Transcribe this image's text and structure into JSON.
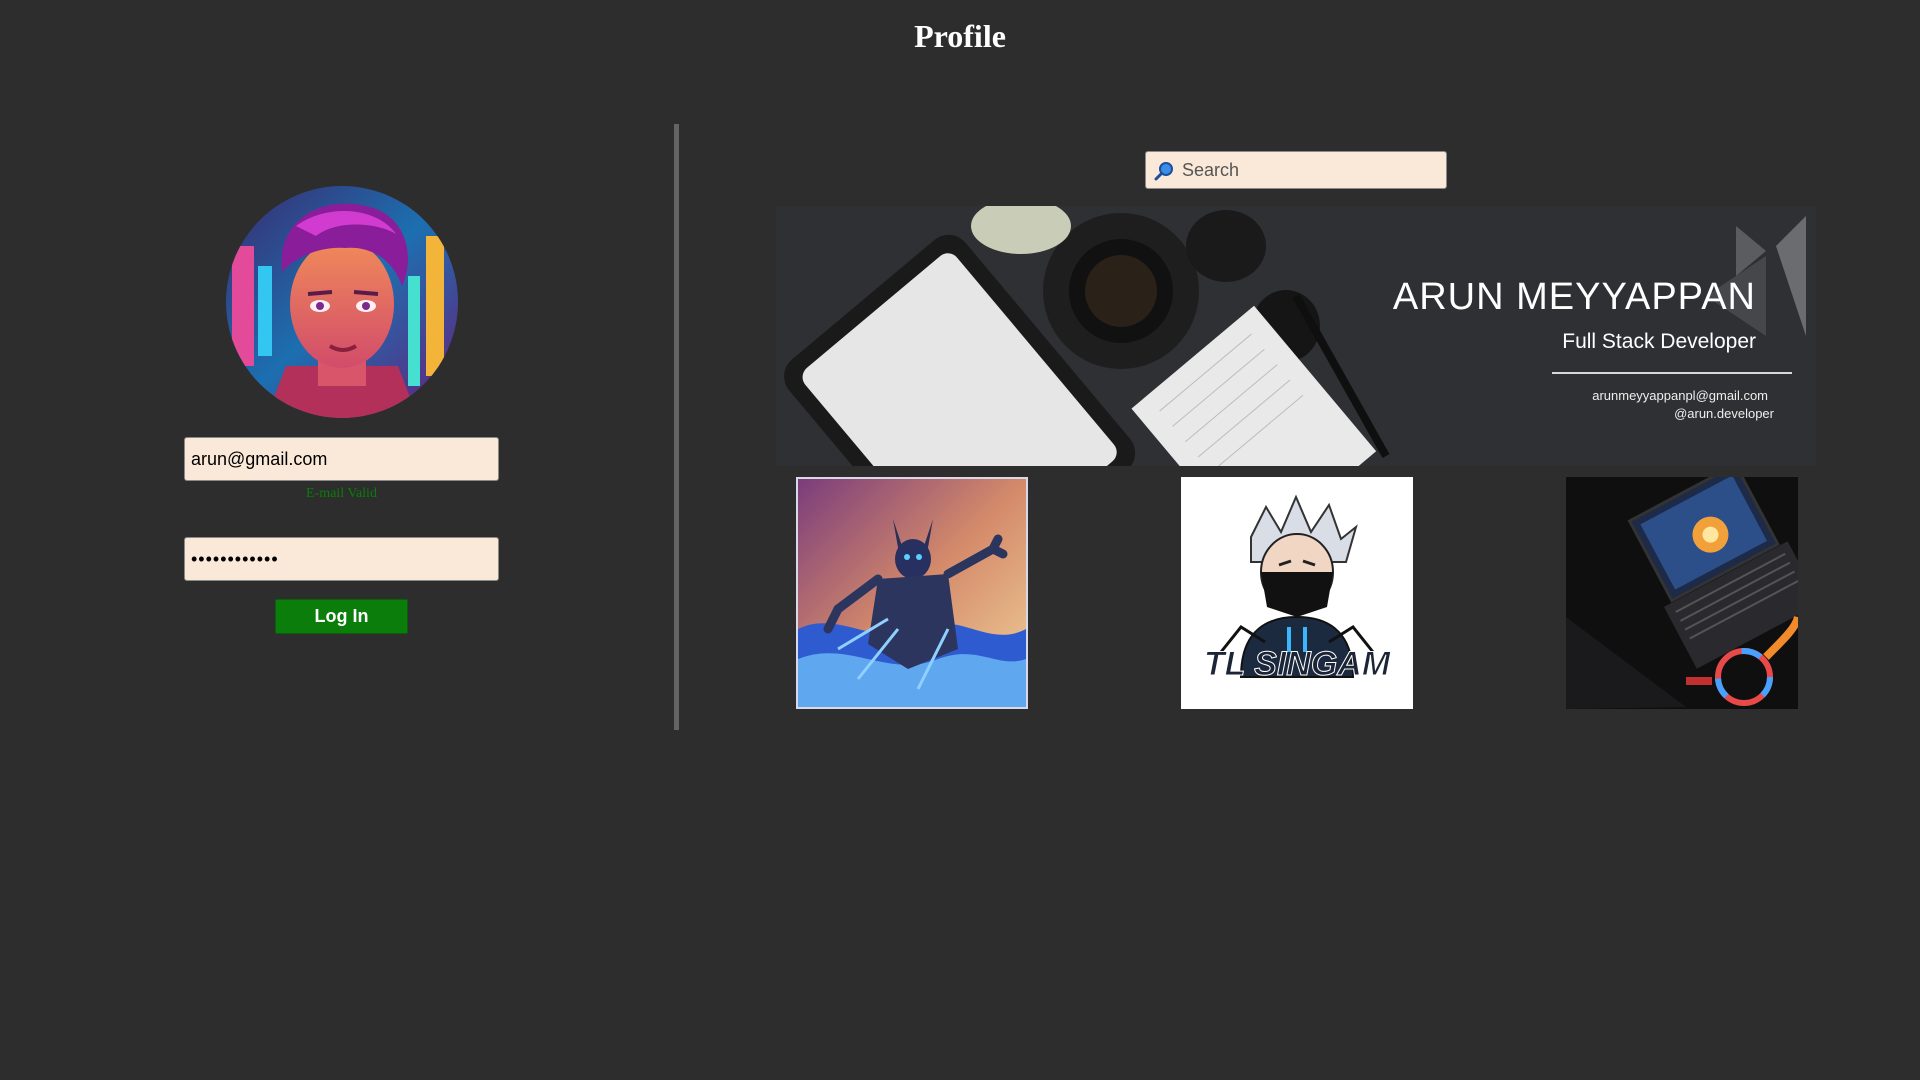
{
  "header": {
    "title": "Profile"
  },
  "login": {
    "email_value": "arun@gmail.com",
    "email_status": "E-mail Valid",
    "password_value": "••••••••••••",
    "login_label": "Log In"
  },
  "search": {
    "placeholder": "Search"
  },
  "banner": {
    "name": "ARUN MEYYAPPAN",
    "role": "Full Stack Developer",
    "email": "arunmeyyappanpl@gmail.com",
    "handle": "@arun.developer"
  },
  "gallery": {
    "logo_text": "TL SINGAM"
  },
  "colors": {
    "background": "#2d2d2d",
    "input_bg": "#fae9d8",
    "accent_green": "#0a7d0a"
  }
}
